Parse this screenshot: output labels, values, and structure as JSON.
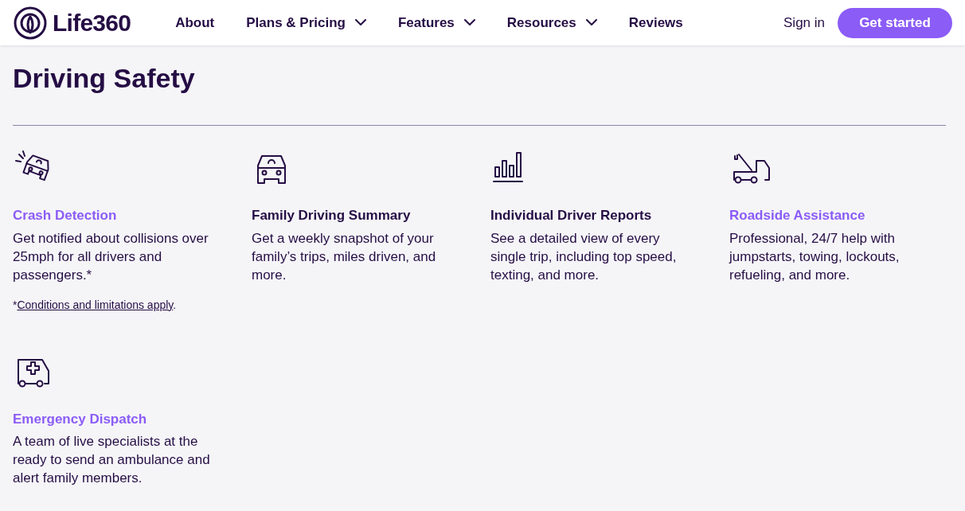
{
  "header": {
    "logo": "Life360",
    "nav": [
      {
        "label": "About",
        "dropdown": false
      },
      {
        "label": "Plans & Pricing",
        "dropdown": true
      },
      {
        "label": "Features",
        "dropdown": true
      },
      {
        "label": "Resources",
        "dropdown": true
      },
      {
        "label": "Reviews",
        "dropdown": false
      }
    ],
    "sign_in": "Sign in",
    "cta": "Get started"
  },
  "section": {
    "title": "Driving Safety",
    "features": [
      {
        "title": "Crash Detection",
        "color": "#8b5cf6",
        "text": "Get notified about collisions over 25mph for all drivers and passengers.*",
        "note": {
          "prefix": "*",
          "link": "Conditions and limitations apply",
          "suffix": "."
        }
      },
      {
        "title": "Family Driving Summary",
        "color": "#250d44",
        "text": "Get a weekly snapshot of your family’s trips, miles driven, and more."
      },
      {
        "title": "Individual Driver Reports",
        "color": "#250d44",
        "text": "See a detailed view of every single trip, including top speed, texting, and more."
      },
      {
        "title": "Roadside Assistance",
        "color": "#8b5cf6",
        "text": "Professional, 24/7 help with jumpstarts, towing, lockouts, refueling, and more."
      },
      {
        "title": "Emergency Dispatch",
        "color": "#8b5cf6",
        "text": "A team of live specialists at the ready to send an ambulance and alert family members."
      }
    ]
  }
}
